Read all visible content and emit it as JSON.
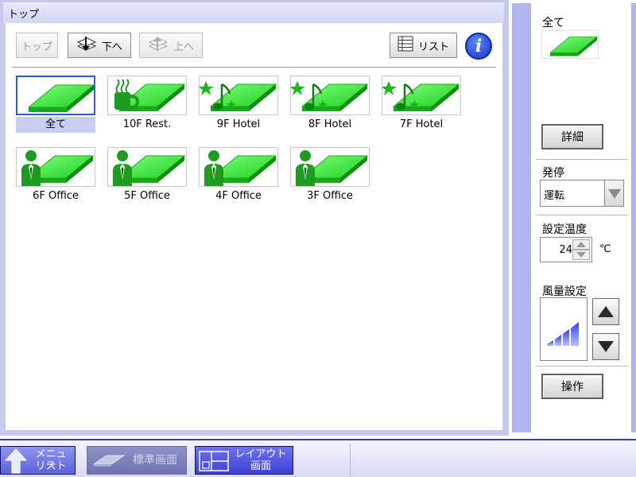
{
  "main": {
    "title": "トップ",
    "toolbar": {
      "top_label": "トップ",
      "down_label": "下へ",
      "up_label": "上へ",
      "list_label": "リスト",
      "info_label": "i"
    },
    "areas": [
      {
        "label": "全て",
        "icon": "all-floors",
        "selected": true
      },
      {
        "label": "10F Rest.",
        "icon": "restaurant-cup"
      },
      {
        "label": "9F Hotel",
        "icon": "hotel-music"
      },
      {
        "label": "8F Hotel",
        "icon": "hotel-music"
      },
      {
        "label": "7F Hotel",
        "icon": "hotel-music"
      },
      {
        "label": "6F Office",
        "icon": "office-person"
      },
      {
        "label": "5F Office",
        "icon": "office-person"
      },
      {
        "label": "4F Office",
        "icon": "office-person"
      },
      {
        "label": "3F Office",
        "icon": "office-person"
      }
    ]
  },
  "side": {
    "selected_area_label": "全て",
    "detail_label": "詳細",
    "power_label": "発停",
    "power_value": "運転",
    "temp_label": "設定温度",
    "temp_value": "24",
    "temp_unit": "℃",
    "fan_label": "風量設定",
    "operate_label": "操作"
  },
  "bottom": {
    "menu_line1": "メニュー",
    "menu_line2": "リスト",
    "standard_label": "標準画面",
    "layout_line1": "レイアウト",
    "layout_line2": "画面"
  },
  "colors": {
    "accent": "#3a3cc0",
    "floor_green": "#33dd33",
    "selection": "#c8cdf1"
  }
}
